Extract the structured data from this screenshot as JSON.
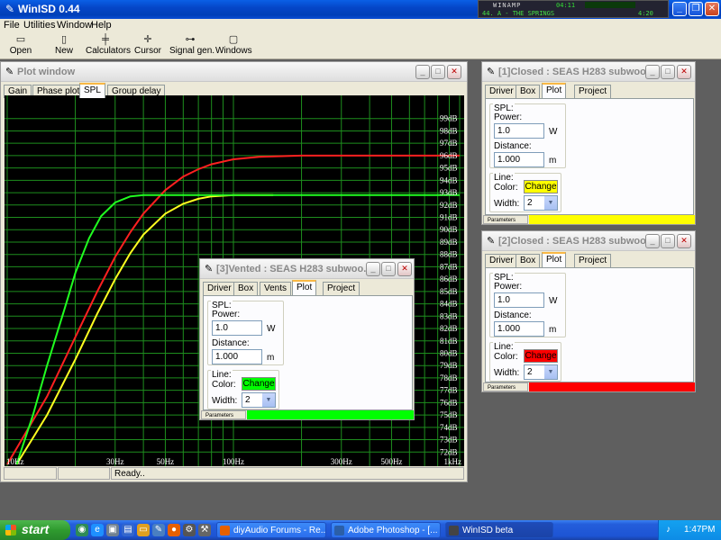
{
  "app": {
    "title": "WinISD 0.44"
  },
  "winamp": {
    "label": "WINAMP",
    "track": "44. A - THE SPRINGS",
    "time": "4:20",
    "elapsed": "04:11"
  },
  "menu": [
    "File",
    "Utilities",
    "Window",
    "Help"
  ],
  "toolbar": [
    {
      "label": "Open",
      "icon": "folder-icon"
    },
    {
      "label": "New",
      "icon": "new-icon"
    },
    {
      "label": "Calculators",
      "icon": "calculator-icon"
    },
    {
      "label": "Cursor",
      "icon": "cursor-icon"
    },
    {
      "label": "Signal gen.",
      "icon": "signal-icon"
    },
    {
      "label": "Windows",
      "icon": "windows-icon"
    }
  ],
  "plot_window": {
    "title": "Plot window",
    "tabs": [
      "Gain",
      "Phase plot",
      "SPL",
      "Group delay"
    ],
    "active_tab": "SPL",
    "status": "Ready.."
  },
  "chart_data": {
    "type": "line",
    "x_scale": "log",
    "xlim": [
      10,
      1000
    ],
    "ylim": [
      71,
      100
    ],
    "x_ticks": [
      {
        "v": 10,
        "label": "10Hz"
      },
      {
        "v": 30,
        "label": "30Hz"
      },
      {
        "v": 50,
        "label": "50Hz"
      },
      {
        "v": 100,
        "label": "100Hz"
      },
      {
        "v": 300,
        "label": "300Hz"
      },
      {
        "v": 500,
        "label": "500Hz"
      },
      {
        "v": 1000,
        "label": "1kHz"
      }
    ],
    "y_ticks": [
      72,
      73,
      74,
      75,
      76,
      77,
      78,
      79,
      80,
      81,
      82,
      83,
      84,
      85,
      86,
      87,
      88,
      89,
      90,
      91,
      92,
      93,
      94,
      95,
      96,
      97,
      98,
      99
    ],
    "y_unit": "dB",
    "grid": true,
    "series": [
      {
        "color": "#ff2020",
        "points": [
          [
            10,
            71
          ],
          [
            15,
            76.5
          ],
          [
            20,
            81.3
          ],
          [
            25,
            85
          ],
          [
            30,
            87.8
          ],
          [
            35,
            89.8
          ],
          [
            40,
            91.3
          ],
          [
            50,
            93.2
          ],
          [
            60,
            94.3
          ],
          [
            70,
            94.9
          ],
          [
            80,
            95.3
          ],
          [
            100,
            95.7
          ],
          [
            130,
            95.9
          ],
          [
            200,
            96
          ],
          [
            1000,
            96
          ]
        ]
      },
      {
        "color": "#ffff20",
        "points": [
          [
            11,
            71
          ],
          [
            15,
            75
          ],
          [
            20,
            79.5
          ],
          [
            25,
            83.2
          ],
          [
            30,
            86
          ],
          [
            35,
            88.1
          ],
          [
            40,
            89.6
          ],
          [
            50,
            91.3
          ],
          [
            60,
            92.1
          ],
          [
            70,
            92.5
          ],
          [
            80,
            92.7
          ],
          [
            100,
            92.8
          ],
          [
            150,
            92.8
          ]
        ]
      },
      {
        "color": "#20ff20",
        "points": [
          [
            11,
            71
          ],
          [
            13,
            75
          ],
          [
            15,
            79
          ],
          [
            18,
            83.7
          ],
          [
            20,
            86.5
          ],
          [
            23,
            89.3
          ],
          [
            26,
            91.1
          ],
          [
            30,
            92.2
          ],
          [
            35,
            92.7
          ],
          [
            40,
            92.8
          ],
          [
            60,
            92.8
          ],
          [
            1000,
            92.8
          ]
        ]
      }
    ]
  },
  "windows": {
    "w1": {
      "title": "[1]Closed : SEAS H283 subwoof...",
      "tabs": [
        "Driver",
        "Box",
        "Plot",
        "Project"
      ],
      "spl_label": "SPL:",
      "power_label": "Power:",
      "power": "1.0",
      "power_unit": "W",
      "distance_label": "Distance:",
      "distance": "1.000",
      "distance_unit": "m",
      "line_label": "Line:",
      "color_label": "Color:",
      "change_label": "Change",
      "width_label": "Width:",
      "width": "2",
      "params_label": "Parameters",
      "color": "#ffff00"
    },
    "w2": {
      "title": "[2]Closed : SEAS H283 subwoof...",
      "tabs": [
        "Driver",
        "Box",
        "Plot",
        "Project"
      ],
      "spl_label": "SPL:",
      "power_label": "Power:",
      "power": "1.0",
      "power_unit": "W",
      "distance_label": "Distance:",
      "distance": "1.000",
      "distance_unit": "m",
      "line_label": "Line:",
      "color_label": "Color:",
      "change_label": "Change",
      "width_label": "Width:",
      "width": "2",
      "params_label": "Parameters",
      "color": "#ff0000"
    },
    "w3": {
      "title": "[3]Vented : SEAS H283 subwoo...",
      "tabs": [
        "Driver",
        "Box",
        "Vents",
        "Plot",
        "Project"
      ],
      "spl_label": "SPL:",
      "power_label": "Power:",
      "power": "1.0",
      "power_unit": "W",
      "distance_label": "Distance:",
      "distance": "1.000",
      "distance_unit": "m",
      "line_label": "Line:",
      "color_label": "Color:",
      "change_label": "Change",
      "width_label": "Width:",
      "width": "2",
      "params_label": "Parameters",
      "color": "#00ff00"
    }
  },
  "taskbar": {
    "start": "start",
    "tasks": [
      "diyAudio Forums - Re...",
      "Adobe Photoshop - [...",
      "WinISD beta"
    ],
    "clock": "1:47PM"
  }
}
